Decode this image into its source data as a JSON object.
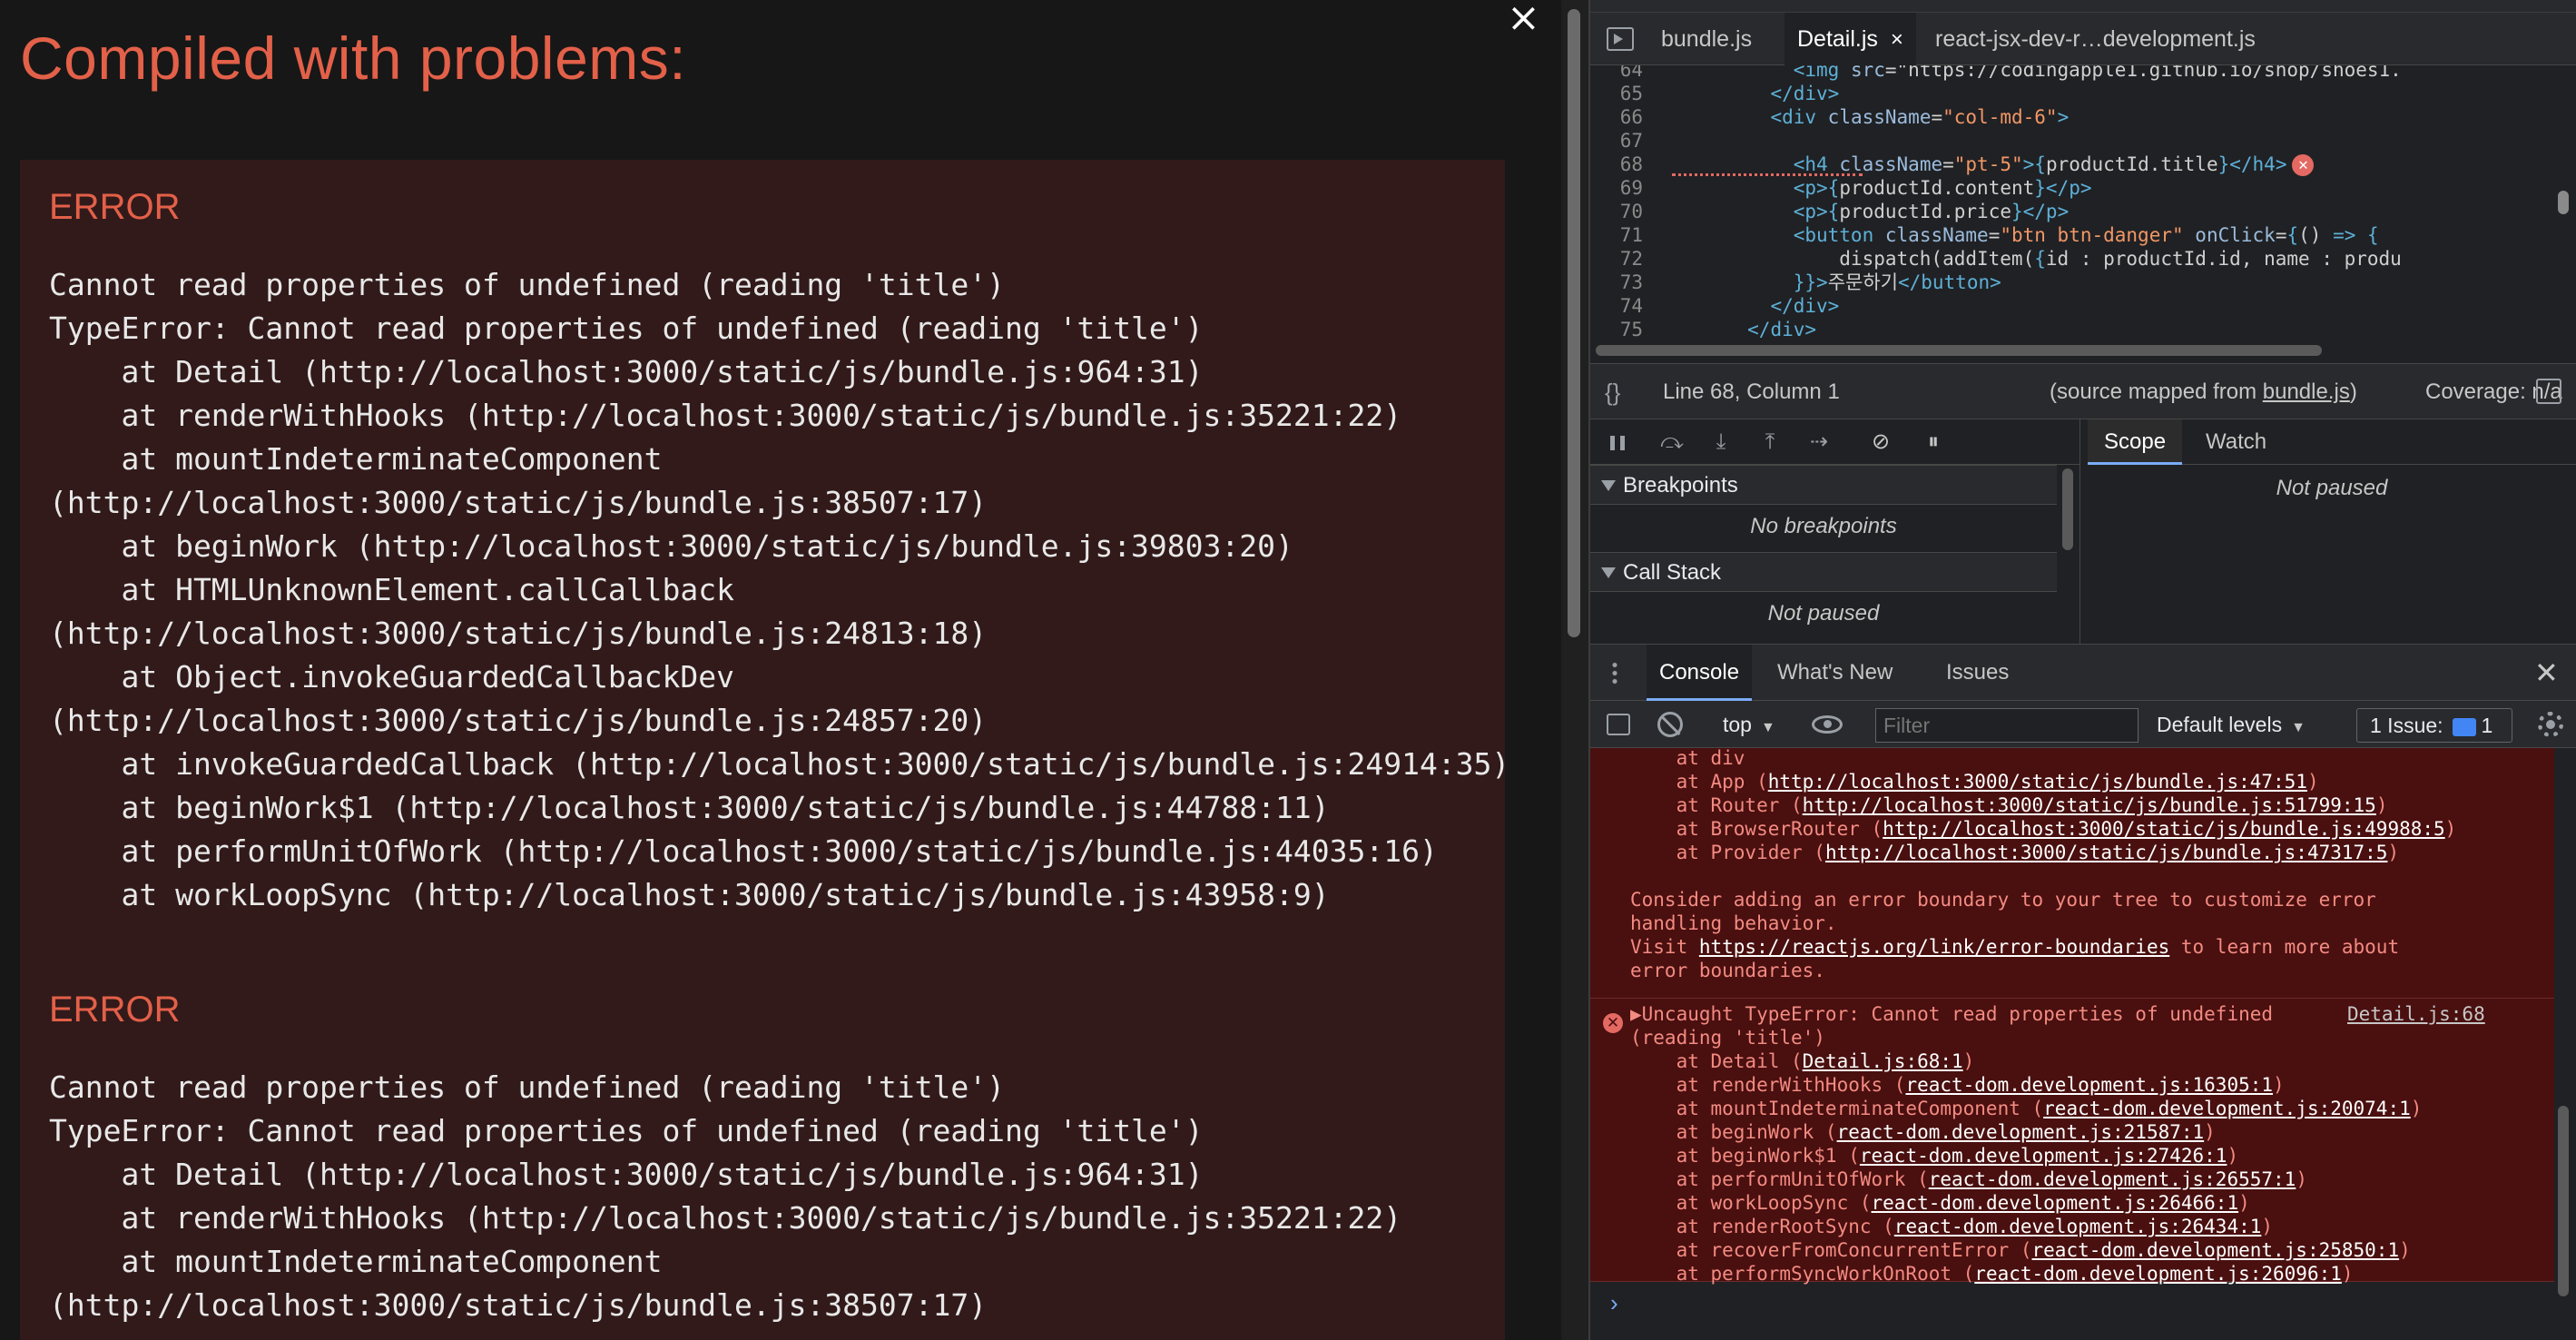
{
  "overlay": {
    "title": "Compiled with problems:",
    "close_glyph": "×",
    "errors": [
      {
        "heading": "ERROR",
        "lines": [
          "Cannot read properties of undefined (reading 'title')",
          "TypeError: Cannot read properties of undefined (reading 'title')",
          "    at Detail (http://localhost:3000/static/js/bundle.js:964:31)",
          "    at renderWithHooks (http://localhost:3000/static/js/bundle.js:35221:22)",
          "    at mountIndeterminateComponent",
          "(http://localhost:3000/static/js/bundle.js:38507:17)",
          "    at beginWork (http://localhost:3000/static/js/bundle.js:39803:20)",
          "    at HTMLUnknownElement.callCallback",
          "(http://localhost:3000/static/js/bundle.js:24813:18)",
          "    at Object.invokeGuardedCallbackDev",
          "(http://localhost:3000/static/js/bundle.js:24857:20)",
          "    at invokeGuardedCallback (http://localhost:3000/static/js/bundle.js:24914:35)",
          "    at beginWork$1 (http://localhost:3000/static/js/bundle.js:44788:11)",
          "    at performUnitOfWork (http://localhost:3000/static/js/bundle.js:44035:16)",
          "    at workLoopSync (http://localhost:3000/static/js/bundle.js:43958:9)"
        ]
      },
      {
        "heading": "ERROR",
        "lines": [
          "Cannot read properties of undefined (reading 'title')",
          "TypeError: Cannot read properties of undefined (reading 'title')",
          "    at Detail (http://localhost:3000/static/js/bundle.js:964:31)",
          "    at renderWithHooks (http://localhost:3000/static/js/bundle.js:35221:22)",
          "    at mountIndeterminateComponent",
          "(http://localhost:3000/static/js/bundle.js:38507:17)"
        ]
      }
    ]
  },
  "devtools": {
    "file_tabs": [
      {
        "label": "bundle.js",
        "active": false
      },
      {
        "label": "Detail.js",
        "active": true,
        "close": "×"
      },
      {
        "label": "react-jsx-dev-r…development.js",
        "active": false
      }
    ],
    "code": {
      "lines": [
        {
          "n": "64",
          "text": "            <img src=\"https://codingapple1.github.io/shop/shoes1."
        },
        {
          "n": "65",
          "text": "          </div>"
        },
        {
          "n": "66",
          "text": "          <div className=\"col-md-6\">"
        },
        {
          "n": "67",
          "text": ""
        },
        {
          "n": "68",
          "text": "            <h4 className=\"pt-5\">{productId.title}</h4>"
        },
        {
          "n": "69",
          "text": "            <p>{productId.content}</p>"
        },
        {
          "n": "70",
          "text": "            <p>{productId.price}</p>"
        },
        {
          "n": "71",
          "text": "            <button className=\"btn btn-danger\" onClick={() => {"
        },
        {
          "n": "72",
          "text": "                dispatch(addItem({id : productId.id, name : produ"
        },
        {
          "n": "73",
          "text": "            }}>주문하기</button>"
        },
        {
          "n": "74",
          "text": "          </div>"
        },
        {
          "n": "75",
          "text": "        </div>"
        }
      ],
      "error_mark": "✕"
    },
    "status": {
      "brace": "{}",
      "position": "Line 68, Column 1",
      "source_prefix": "(source mapped from ",
      "source_link": "bundle.js",
      "source_suffix": ")",
      "coverage": "Coverage: n/a"
    },
    "debugger": {
      "sections": [
        {
          "title": "Breakpoints",
          "empty": "No breakpoints"
        },
        {
          "title": "Call Stack",
          "empty": "Not paused"
        }
      ],
      "tabs": [
        "Scope",
        "Watch"
      ],
      "scope_status": "Not paused"
    },
    "console_tabs": [
      "Console",
      "What's New",
      "Issues"
    ],
    "console_close": "✕",
    "toolbar": {
      "context": "top",
      "filter_placeholder": "Filter",
      "levels": "Default levels",
      "issues": "1 Issue:",
      "issues_count": "1"
    },
    "console": {
      "block_a": [
        [
          {
            "t": "    at div"
          }
        ],
        [
          {
            "t": "    at App ("
          },
          {
            "t": "http://localhost:3000/static/js/bundle.js:47:51",
            "u": 1
          },
          {
            "t": ")"
          }
        ],
        [
          {
            "t": "    at Router ("
          },
          {
            "t": "http://localhost:3000/static/js/bundle.js:51799:15",
            "u": 1
          },
          {
            "t": ")"
          }
        ],
        [
          {
            "t": "    at BrowserRouter ("
          },
          {
            "t": "http://localhost:3000/static/js/bundle.js:49988:5",
            "u": 1
          },
          {
            "t": ")"
          }
        ],
        [
          {
            "t": "    at Provider ("
          },
          {
            "t": "http://localhost:3000/static/js/bundle.js:47317:5",
            "u": 1
          },
          {
            "t": ")"
          }
        ],
        [
          {
            "t": ""
          }
        ],
        [
          {
            "t": "Consider adding an error boundary to your tree to customize error"
          }
        ],
        [
          {
            "t": "handling behavior."
          }
        ],
        [
          {
            "t": "Visit "
          },
          {
            "t": "https://reactjs.org/link/error-boundaries",
            "u": 1
          },
          {
            "t": " to learn more about"
          }
        ],
        [
          {
            "t": "error boundaries."
          }
        ]
      ],
      "block_b_head": "▶Uncaught TypeError: Cannot read properties of undefined",
      "block_b_source": "Detail.js:68",
      "block_b": [
        [
          {
            "t": "(reading 'title')"
          }
        ],
        [
          {
            "t": "    at Detail ("
          },
          {
            "t": "Detail.js:68:1",
            "u": 1
          },
          {
            "t": ")"
          }
        ],
        [
          {
            "t": "    at renderWithHooks ("
          },
          {
            "t": "react-dom.development.js:16305:1",
            "u": 1
          },
          {
            "t": ")"
          }
        ],
        [
          {
            "t": "    at mountIndeterminateComponent ("
          },
          {
            "t": "react-dom.development.js:20074:1",
            "u": 1
          },
          {
            "t": ")"
          }
        ],
        [
          {
            "t": "    at beginWork ("
          },
          {
            "t": "react-dom.development.js:21587:1",
            "u": 1
          },
          {
            "t": ")"
          }
        ],
        [
          {
            "t": "    at beginWork$1 ("
          },
          {
            "t": "react-dom.development.js:27426:1",
            "u": 1
          },
          {
            "t": ")"
          }
        ],
        [
          {
            "t": "    at performUnitOfWork ("
          },
          {
            "t": "react-dom.development.js:26557:1",
            "u": 1
          },
          {
            "t": ")"
          }
        ],
        [
          {
            "t": "    at workLoopSync ("
          },
          {
            "t": "react-dom.development.js:26466:1",
            "u": 1
          },
          {
            "t": ")"
          }
        ],
        [
          {
            "t": "    at renderRootSync ("
          },
          {
            "t": "react-dom.development.js:26434:1",
            "u": 1
          },
          {
            "t": ")"
          }
        ],
        [
          {
            "t": "    at recoverFromConcurrentError ("
          },
          {
            "t": "react-dom.development.js:25850:1",
            "u": 1
          },
          {
            "t": ")"
          }
        ],
        [
          {
            "t": "    at performSyncWorkOnRoot ("
          },
          {
            "t": "react-dom.development.js:26096:1",
            "u": 1
          },
          {
            "t": ")"
          }
        ]
      ],
      "prompt": "›"
    }
  }
}
